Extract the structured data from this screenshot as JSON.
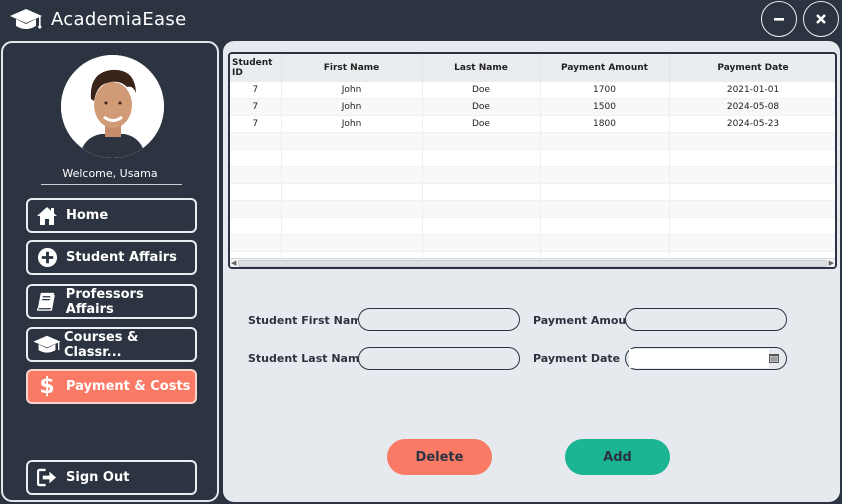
{
  "app": {
    "title": "AcademiaEase"
  },
  "window": {
    "minimize_icon": "minus-icon",
    "close_icon": "close-icon"
  },
  "sidebar": {
    "welcome": "Welcome, Usama",
    "items": [
      {
        "label": "Home",
        "icon": "home-icon"
      },
      {
        "label": "Student Affairs",
        "icon": "plus-circle-icon"
      },
      {
        "label": "Professors Affairs",
        "icon": "book-icon"
      },
      {
        "label": "Courses & Classr...",
        "icon": "graduation-cap-icon"
      },
      {
        "label": "Payment & Costs",
        "icon": "dollar-icon",
        "active": true
      }
    ],
    "signout": {
      "label": "Sign Out",
      "icon": "sign-out-icon"
    }
  },
  "table": {
    "columns": [
      "Student ID",
      "First Name",
      "Last Name",
      "Payment Amount",
      "Payment Date"
    ],
    "rows": [
      [
        "7",
        "John",
        "Doe",
        "1700",
        "2021-01-01"
      ],
      [
        "7",
        "John",
        "Doe",
        "1500",
        "2024-05-08"
      ],
      [
        "7",
        "John",
        "Doe",
        "1800",
        "2024-05-23"
      ]
    ]
  },
  "form": {
    "first_name_label": "Student First Name",
    "last_name_label": "Student Last Name",
    "amount_label": "Payment Amount",
    "date_label": "Payment Date",
    "first_name_value": "",
    "last_name_value": "",
    "amount_value": "",
    "date_value": ""
  },
  "actions": {
    "delete_label": "Delete",
    "add_label": "Add"
  },
  "colors": {
    "background": "#2b3440",
    "panel": "#e6eaee",
    "accent": "#fa7a66",
    "add": "#1bb594",
    "delete": "#fa7a66"
  }
}
